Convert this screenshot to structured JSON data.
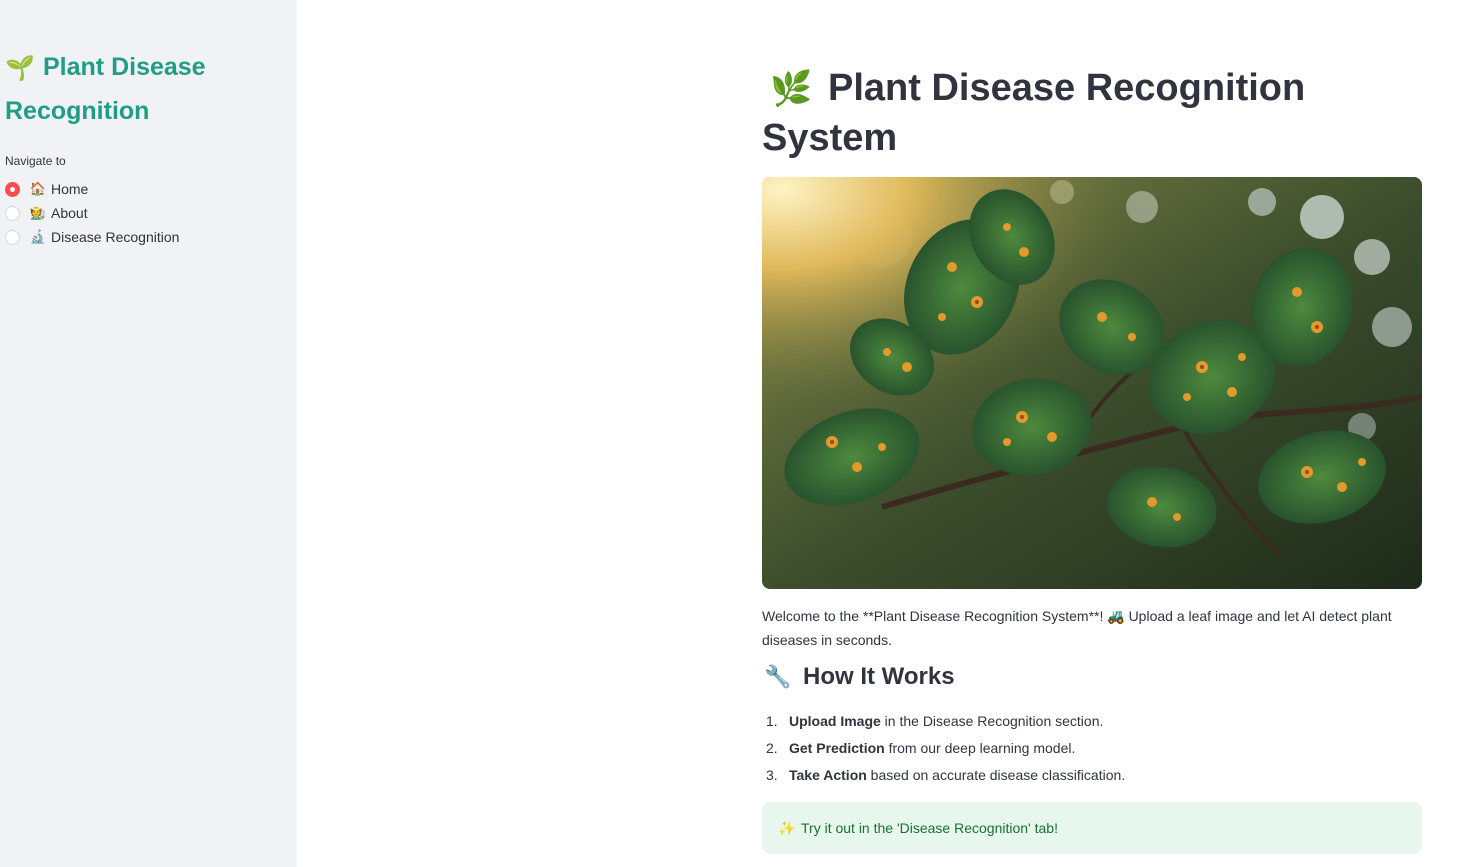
{
  "sidebar": {
    "title_emoji": "🌱",
    "title": "Plant Disease Recognition",
    "nav_label": "Navigate to",
    "items": [
      {
        "emoji": "🏠",
        "label": "Home",
        "selected": true
      },
      {
        "emoji": "🧑‍🌾",
        "label": "About",
        "selected": false
      },
      {
        "emoji": "🔬",
        "label": "Disease Recognition",
        "selected": false
      }
    ]
  },
  "main": {
    "title_emoji": "🌿",
    "title": "Plant Disease Recognition System",
    "welcome_text": "Welcome to the **Plant Disease Recognition System**! 🚜 Upload a leaf image and let AI detect plant diseases in seconds.",
    "how_it_works": {
      "emoji": "🔧",
      "heading": "How It Works",
      "steps": [
        {
          "number": "1.",
          "bold": "Upload Image",
          "rest": " in the Disease Recognition section."
        },
        {
          "number": "2.",
          "bold": "Get Prediction",
          "rest": " from our deep learning model."
        },
        {
          "number": "3.",
          "bold": "Take Action",
          "rest": " based on accurate disease classification."
        }
      ]
    },
    "callout": {
      "emoji": "✨",
      "text": "Try it out in the 'Disease Recognition' tab!"
    }
  },
  "colors": {
    "sidebar_bg": "#f0f2f6",
    "sidebar_title": "#1f9e84",
    "radio_selected": "#ff4b4b",
    "callout_bg": "#e8f7ee",
    "callout_text": "#177233"
  },
  "icons": [
    "seedling-icon",
    "house-icon",
    "farmer-icon",
    "microscope-icon",
    "herb-icon",
    "tractor-icon",
    "wrench-icon",
    "sparkles-icon"
  ]
}
